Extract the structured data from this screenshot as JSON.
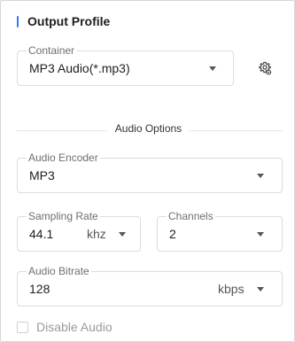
{
  "header": {
    "title": "Output Profile"
  },
  "container": {
    "label": "Container",
    "value": "MP3 Audio(*.mp3)",
    "settings_icon": "gear-icon"
  },
  "section": {
    "title": "Audio Options"
  },
  "audio_encoder": {
    "label": "Audio Encoder",
    "value": "MP3"
  },
  "sampling_rate": {
    "label": "Sampling Rate",
    "value": "44.1",
    "unit": "khz"
  },
  "channels": {
    "label": "Channels",
    "value": "2"
  },
  "audio_bitrate": {
    "label": "Audio Bitrate",
    "value": "128",
    "unit": "kbps"
  },
  "disable_audio": {
    "label": "Disable Audio",
    "checked": false
  },
  "colors": {
    "accent": "#2f7cf6"
  }
}
